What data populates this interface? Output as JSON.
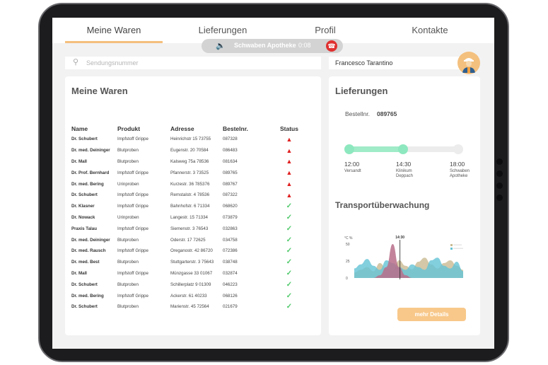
{
  "nav": {
    "tabs": [
      {
        "label": "Meine Waren",
        "active": true
      },
      {
        "label": "Lieferungen",
        "active": false
      },
      {
        "label": "Profil",
        "active": false
      },
      {
        "label": "Kontakte",
        "active": false
      }
    ]
  },
  "call": {
    "name": "Schwaben Apotheke",
    "time": "0:08",
    "speaker_icon": "speaker-icon",
    "hangup_icon": "phone-hangup-icon"
  },
  "search": {
    "placeholder": "Sendungsnummer",
    "value": ""
  },
  "user": {
    "name": "Francesco Tarantino"
  },
  "orders": {
    "title": "Meine Waren",
    "columns": [
      "Name",
      "Produkt",
      "Adresse",
      "Bestelnr.",
      "Status"
    ],
    "rows": [
      {
        "name": "Dr. Schubert",
        "product": "Impfstoff Grippe",
        "address": "Heinrichstr 15 73755",
        "number": "087328",
        "status": "warning"
      },
      {
        "name": "Dr. med. Deininger",
        "product": "Blutproben",
        "address": "Eugenstr. 20 70584",
        "number": "086483",
        "status": "warning"
      },
      {
        "name": "Dr. Mall",
        "product": "Blutproben",
        "address": "Kalsweg 75a 78536",
        "number": "081634",
        "status": "warning"
      },
      {
        "name": "Dr. Prof. Bernhard",
        "product": "Impfstoff Grippe",
        "address": "Pfannerstr. 3 73525",
        "number": "089765",
        "status": "warning"
      },
      {
        "name": "Dr. med. Bering",
        "product": "Urinproben",
        "address": "Kurzestr. 36 785376",
        "number": "089767",
        "status": "warning"
      },
      {
        "name": "Dr. Schubert",
        "product": "Impfstoff Grippe",
        "address": "Remstalstr. 4 78536",
        "number": "087322",
        "status": "warning"
      },
      {
        "name": "Dr. Klasner",
        "product": "Impfstoff Grippe",
        "address": "Bahnhofstr. 6 71334",
        "number": "068620",
        "status": "ok"
      },
      {
        "name": "Dr. Nowack",
        "product": "Urinproben",
        "address": "Langestr. 15 71334",
        "number": "073879",
        "status": "ok"
      },
      {
        "name": "Praxis Talau",
        "product": "Impfstoff Grippe",
        "address": "Siemenstr. 3 76543",
        "number": "032863",
        "status": "ok"
      },
      {
        "name": "Dr. med. Deininger",
        "product": "Blutproben",
        "address": "Oderstr. 17 72625",
        "number": "034758",
        "status": "ok"
      },
      {
        "name": "Dr. med. Rausch",
        "product": "Impfstoff Grippe",
        "address": "Oreganostr. 42 86720",
        "number": "072386",
        "status": "ok"
      },
      {
        "name": "Dr. med. Best",
        "product": "Blutproben",
        "address": "Stuttgarterstr. 3 75643",
        "number": "038748",
        "status": "ok"
      },
      {
        "name": "Dr. Mall",
        "product": "Impfstoff Grippe",
        "address": "Münzgasse 33 01067",
        "number": "032874",
        "status": "ok"
      },
      {
        "name": "Dr. Schubert",
        "product": "Blutproben",
        "address": "Schillerplatz 9 01309",
        "number": "046223",
        "status": "ok"
      },
      {
        "name": "Dr. med. Bering",
        "product": "Impfstoff Grippe",
        "address": "Ackerstr. 61 40233",
        "number": "068126",
        "status": "ok"
      },
      {
        "name": "Dr. Schubert",
        "product": "Blutproben",
        "address": "Marienstr. 45 72564",
        "number": "021679",
        "status": "ok"
      }
    ]
  },
  "delivery": {
    "title": "Lieferungen",
    "order_label": "Bestellnr.",
    "order_number": "089765",
    "progress": 0.5,
    "stops": [
      {
        "time": "12:00",
        "place": "Versandt",
        "reached": true
      },
      {
        "time": "14:30",
        "place": "Klinikum Deppach",
        "reached": true
      },
      {
        "time": "18:00",
        "place": "Schwaben Apotheke",
        "reached": false
      }
    ],
    "colors": {
      "reached": "#8ee8bf",
      "pending": "#ececec"
    }
  },
  "monitoring": {
    "title": "Transportüberwachung",
    "button_label": "mehr Details"
  },
  "chart_data": {
    "type": "area",
    "title": "",
    "ylabel": "°C %",
    "ylim": [
      0,
      50
    ],
    "yticks": [
      "50",
      "25",
      "0"
    ],
    "marker_label": "14:30",
    "marker_position": 0.42,
    "series": [
      {
        "color": "#c9ba92",
        "values": [
          8,
          12,
          16,
          10,
          22,
          14,
          11,
          26,
          18,
          13,
          24,
          30,
          20,
          14,
          22,
          26,
          18,
          12
        ]
      },
      {
        "color": "#63c3d6",
        "values": [
          14,
          20,
          28,
          18,
          12,
          26,
          22,
          16,
          12,
          20,
          16,
          12,
          26,
          30,
          18,
          14,
          24,
          10
        ]
      },
      {
        "color": "#b96f8a",
        "values": [
          0,
          0,
          0,
          0,
          4,
          16,
          50,
          16,
          4,
          0,
          0,
          0,
          0,
          0,
          0,
          0,
          0,
          0
        ]
      }
    ],
    "grid": false
  }
}
